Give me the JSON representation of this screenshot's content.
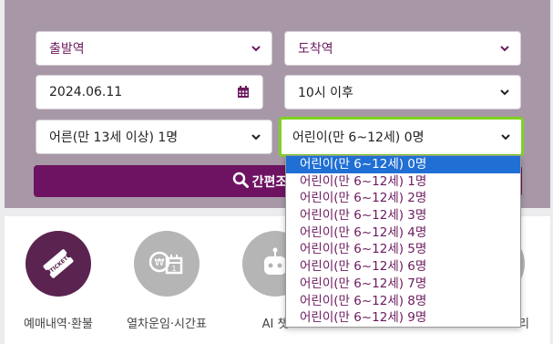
{
  "form": {
    "departure": "출발역",
    "arrival": "도착역",
    "date": "2024.06.11",
    "time": "10시 이후",
    "adult": "어른(만 13세 이상) 1명",
    "child": "어린이(만 6~12세) 0명",
    "search_label": "간편조"
  },
  "child_options": [
    "어린이(만 6~12세) 0명",
    "어린이(만 6~12세) 1명",
    "어린이(만 6~12세) 2명",
    "어린이(만 6~12세) 3명",
    "어린이(만 6~12세) 4명",
    "어린이(만 6~12세) 5명",
    "어린이(만 6~12세) 6명",
    "어린이(만 6~12세) 7명",
    "어린이(만 6~12세) 8명",
    "어린이(만 6~12세) 9명"
  ],
  "menu": {
    "items": [
      {
        "label": "예매내역·환불",
        "icon": "ticket-icon",
        "badge": "TICKET"
      },
      {
        "label": "열차운임·시간표",
        "icon": "fare-calendar-icon"
      },
      {
        "label": "AI 챗",
        "icon": "robot-icon"
      },
      {
        "label": "",
        "icon": ""
      },
      {
        "label": "리",
        "icon": ""
      }
    ]
  },
  "colors": {
    "panel": "#a898a7",
    "accent": "#6e1362",
    "focus": "#7ed321",
    "selected": "#1f6fd4"
  }
}
